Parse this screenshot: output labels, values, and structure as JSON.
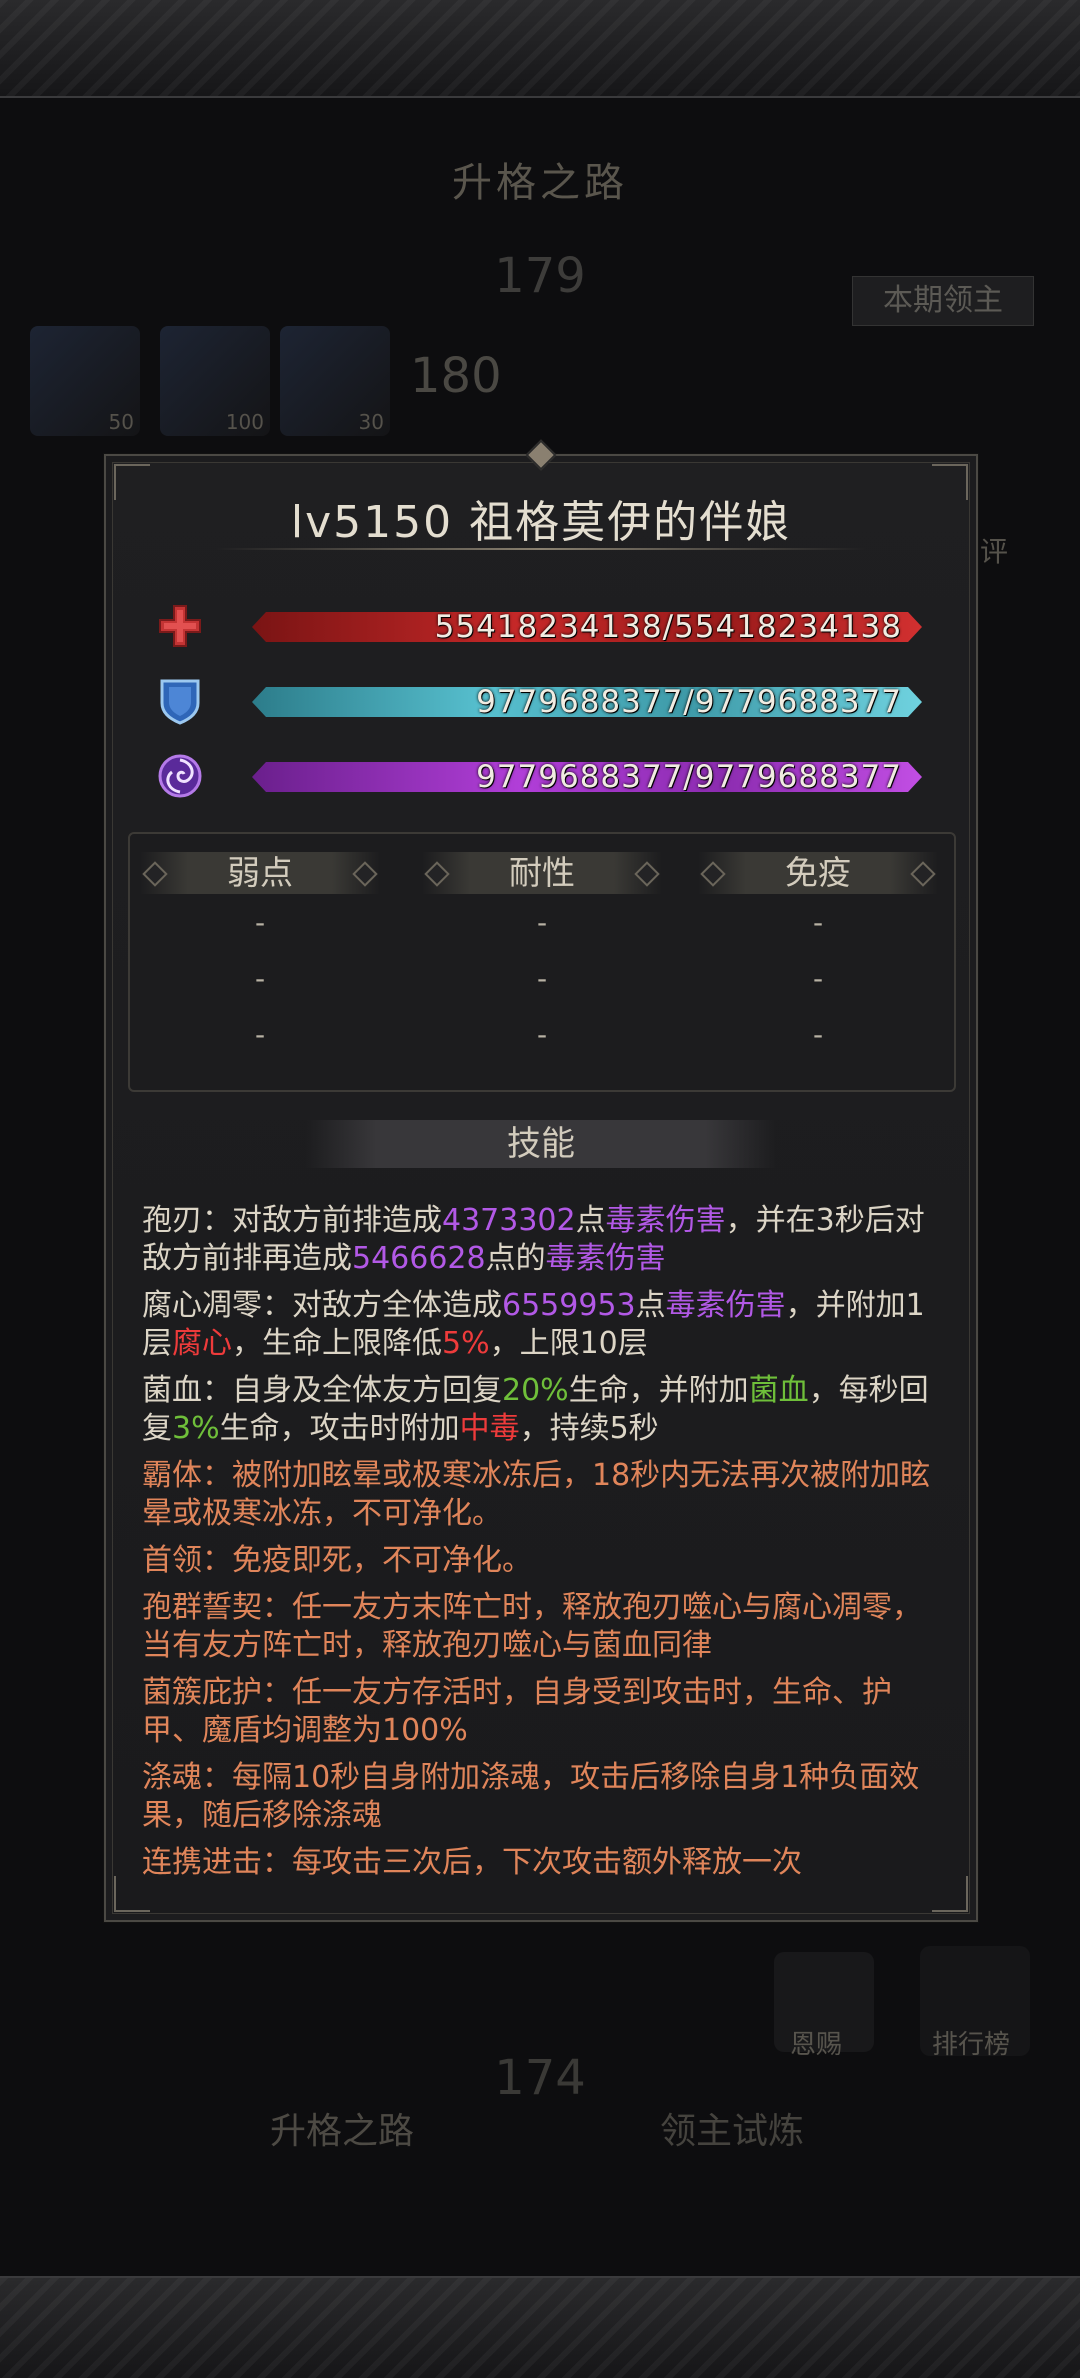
{
  "background": {
    "title": "升格之路",
    "level_179": "179",
    "level_180": "180",
    "boss_tag": "本期领主",
    "items": [
      {
        "count": "50"
      },
      {
        "count": "100"
      },
      {
        "count": "30"
      }
    ],
    "level_174": "174",
    "nav_path": "升格之路",
    "nav_trial": "领主试炼",
    "mask_label": "恩赐",
    "rank_label": "排行榜",
    "edge_text": "评"
  },
  "dialog": {
    "title": "lv5150  祖格莫伊的伴娘",
    "hp": "55418234138/55418234138",
    "armor": "9779688377/9779688377",
    "shield": "9779688377/9779688377",
    "resist_headers": [
      "弱点",
      "耐性",
      "免疫"
    ],
    "resist_rows": [
      [
        "-",
        "-",
        "-"
      ],
      [
        "-",
        "-",
        "-"
      ],
      [
        "-",
        "-",
        "-"
      ]
    ],
    "skills_header": "技能",
    "skills": {
      "s1": {
        "a": "孢刃：对敌方前排造成",
        "b": "4373302",
        "c": "点",
        "d": "毒素伤害",
        "e": "，并在3秒后对敌方前排再造成",
        "f": "5466628",
        "g": "点的",
        "h": "毒素伤害"
      },
      "s2": {
        "a": "腐心凋零：对敌方全体造成",
        "b": "6559953",
        "c": "点",
        "d": "毒素伤害",
        "e": "，并附加1层",
        "f": "腐心",
        "g": "，生命上限降低",
        "h": "5%",
        "i": "，上限10层"
      },
      "s3": {
        "a": "菌血：自身及全体友方回复",
        "b": "20%",
        "c": "生命，并附加",
        "d": "菌血",
        "e": "，每秒回复",
        "f": "3%",
        "g": "生命，攻击时附加",
        "h": "中毒",
        "i": "，持续5秒"
      },
      "s4": "霸体：被附加眩晕或极寒冰冻后，18秒内无法再次被附加眩晕或极寒冰冻，不可净化。",
      "s5": "首领：免疫即死，不可净化。",
      "s6": "孢群誓契：任一友方末阵亡时，释放孢刃噬心与腐心凋零，当有友方阵亡时，释放孢刃噬心与菌血同律",
      "s7": "菌簇庇护：任一友方存活时，自身受到攻击时，生命、护甲、魔盾均调整为100%",
      "s8": "涤魂：每隔10秒自身附加涤魂，攻击后移除自身1种负面效果，随后移除涤魂",
      "s9": "连携进击：每攻击三次后，下次攻击额外释放一次"
    }
  },
  "icons": {
    "hp": "red-cross-icon",
    "armor": "blue-shield-icon",
    "shield": "purple-swirl-icon"
  },
  "colors": {
    "hp": "#c62828",
    "armor": "#57c0cf",
    "shield": "#b13ed8",
    "highlight_purple": "#b259e6",
    "highlight_red": "#ee3b3b",
    "highlight_green": "#6fbf3a",
    "passive_orange": "#e0855a"
  }
}
